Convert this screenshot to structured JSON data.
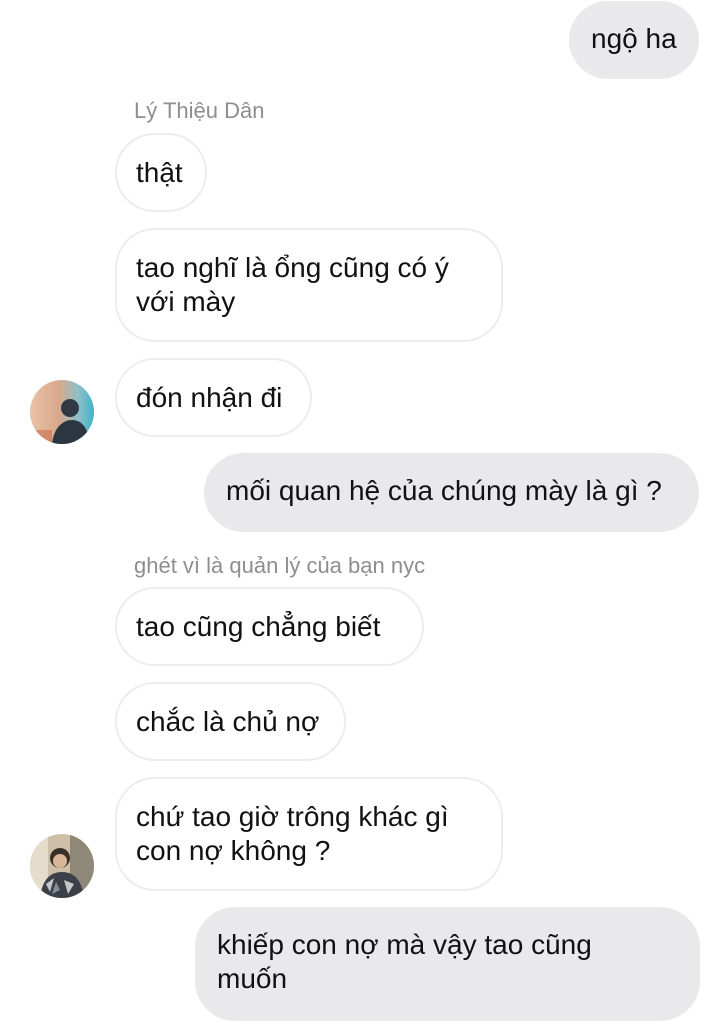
{
  "messages": {
    "m1": "ngộ ha",
    "sender1": "Lý Thiệu Dân",
    "m2": "thật",
    "m3_line1": "tao nghĩ là ổng cũng có ý",
    "m3_line2": "với mày",
    "m4": "đón nhận đi",
    "m5": "mối quan hệ của chúng mày là gì ?",
    "sender2": "ghét vì là quản lý của bạn nyc",
    "m6": "tao cũng chẳng biết",
    "m7": "chắc là chủ nợ",
    "m8_line1": "chứ tao giờ trông khác gì",
    "m8_line2": "con nợ không ?",
    "m9_line1": "khiếp con nợ mà vậy tao cũng",
    "m9_line2": "muốn"
  },
  "colors": {
    "outgoing_bubble": "#e9e9eb",
    "incoming_bubble_border": "#ececec",
    "sender_name": "#8e8e8e",
    "text": "#111111"
  },
  "icons": {
    "avatar1": "profile-photo-icon",
    "avatar2": "profile-photo-icon"
  }
}
